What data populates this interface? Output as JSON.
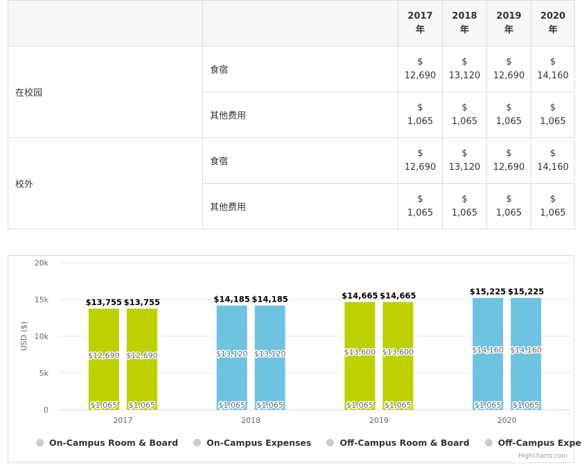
{
  "table": {
    "headers": [
      {
        "top": "2017",
        "bottom": "年"
      },
      {
        "top": "2018",
        "bottom": "年"
      },
      {
        "top": "2019",
        "bottom": "年"
      },
      {
        "top": "2020",
        "bottom": "年"
      }
    ],
    "groups": [
      {
        "label": "在校园",
        "rows": [
          {
            "item": "食宿",
            "values": [
              {
                "cur": "$",
                "num": "12,690"
              },
              {
                "cur": "$",
                "num": "13,120"
              },
              {
                "cur": "$",
                "num": "12,690"
              },
              {
                "cur": "$",
                "num": "14,160"
              }
            ]
          },
          {
            "item": "其他费用",
            "values": [
              {
                "cur": "$",
                "num": "1,065"
              },
              {
                "cur": "$",
                "num": "1,065"
              },
              {
                "cur": "$",
                "num": "1,065"
              },
              {
                "cur": "$",
                "num": "1,065"
              }
            ]
          }
        ]
      },
      {
        "label": "校外",
        "rows": [
          {
            "item": "食宿",
            "values": [
              {
                "cur": "$",
                "num": "12,690"
              },
              {
                "cur": "$",
                "num": "13,120"
              },
              {
                "cur": "$",
                "num": "12,690"
              },
              {
                "cur": "$",
                "num": "14,160"
              }
            ]
          },
          {
            "item": "其他费用",
            "values": [
              {
                "cur": "$",
                "num": "1,065"
              },
              {
                "cur": "$",
                "num": "1,065"
              },
              {
                "cur": "$",
                "num": "1,065"
              },
              {
                "cur": "$",
                "num": "1,065"
              }
            ]
          }
        ]
      }
    ]
  },
  "chart_data": {
    "type": "bar",
    "stacked": true,
    "categories": [
      "2017",
      "2018",
      "2019",
      "2020"
    ],
    "ylabel": "USD ($)",
    "ylim": [
      0,
      20000
    ],
    "yticks": [
      0,
      5000,
      10000,
      15000,
      20000
    ],
    "ytick_labels": [
      "0",
      "5k",
      "10k",
      "15k",
      "20k"
    ],
    "grid": true,
    "legend_position": "bottom",
    "stacks": [
      {
        "name": "On-Campus",
        "top": [
          12690,
          13120,
          13600,
          14160
        ],
        "top_labels": [
          "$12,690",
          "$13,120",
          "$13,600",
          "$14,160"
        ],
        "bottom": [
          1065,
          1065,
          1065,
          1065
        ],
        "bottom_labels": [
          "$1,065",
          "$1,065",
          "$1,065",
          "$1,065"
        ],
        "total_labels": [
          "$13,755",
          "$14,185",
          "$14,665",
          "$15,225"
        ]
      },
      {
        "name": "Off-Campus",
        "top": [
          12690,
          13120,
          13600,
          14160
        ],
        "top_labels": [
          "$12,690",
          "$13,120",
          "$13,600",
          "$14,160"
        ],
        "bottom": [
          1065,
          1065,
          1065,
          1065
        ],
        "bottom_labels": [
          "$1,065",
          "$1,065",
          "$1,065",
          "$1,065"
        ],
        "total_labels": [
          "$13,755",
          "$14,185",
          "$14,665",
          "$15,225"
        ]
      }
    ],
    "category_colors": [
      "#bdd000",
      "#70c3e0",
      "#bdd000",
      "#70c3e0"
    ],
    "legend": [
      "On-Campus Room & Board",
      "On-Campus Expenses",
      "Off-Campus Room & Board",
      "Off-Campus Expenses"
    ],
    "credits": "Highcharts.com"
  }
}
